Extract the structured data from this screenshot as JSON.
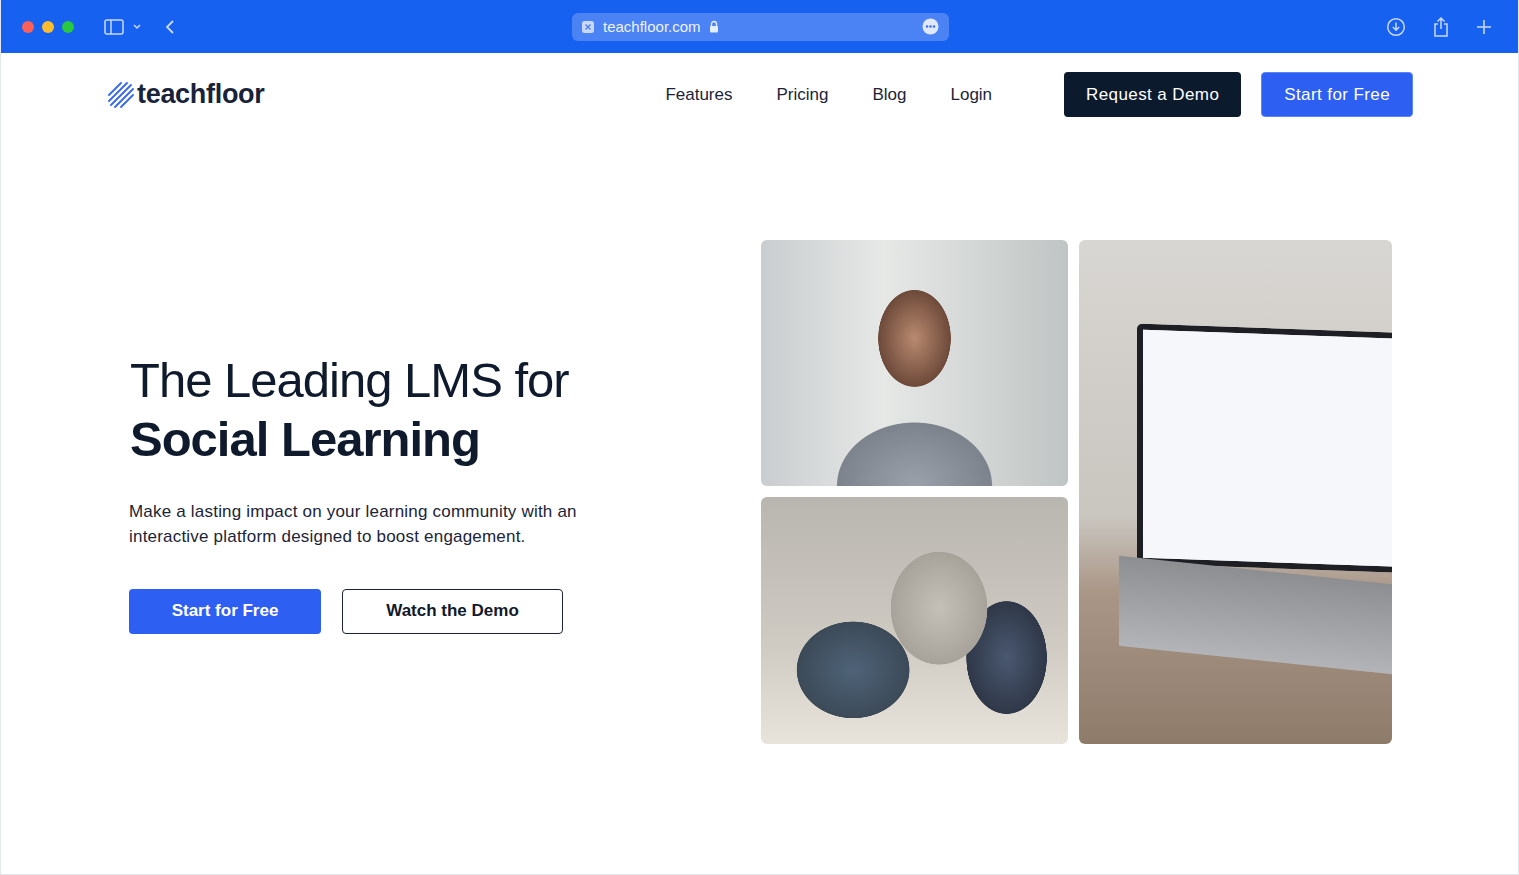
{
  "browser": {
    "address": "teachfloor.com",
    "secure": true
  },
  "nav": {
    "logo": "teachfloor",
    "links": [
      "Features",
      "Pricing",
      "Blog",
      "Login"
    ],
    "buttons": [
      {
        "label": "Request a Demo",
        "kind": "dark"
      },
      {
        "label": "Start for Free",
        "kind": "primary"
      }
    ]
  },
  "hero": {
    "title_line1": "The Leading LMS for",
    "title_line2": "Social Learning",
    "description": "Make a lasting impact on your learning community with an interactive platform designed to boost engagement.",
    "buttons": [
      {
        "label": "Start for Free",
        "kind": "primary"
      },
      {
        "label": "Watch the Demo",
        "kind": "outline"
      }
    ]
  }
}
